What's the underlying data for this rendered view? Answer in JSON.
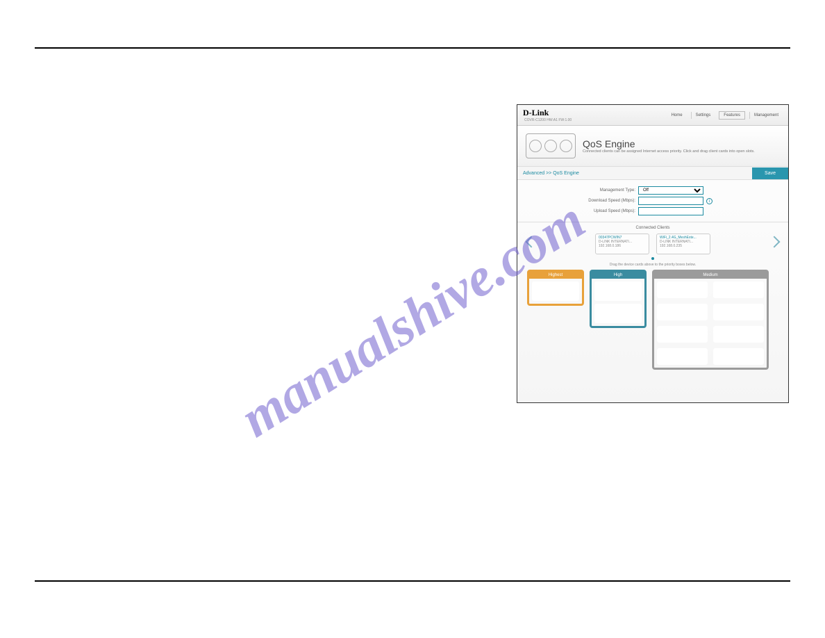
{
  "watermark": "manualshive.com",
  "shot": {
    "brand": "D-Link",
    "model": "COVR-C1200 HW:A1 FW:1.00",
    "nav": {
      "home": "Home",
      "settings": "Settings",
      "features": "Features",
      "management": "Management"
    },
    "banner": {
      "title": "QoS Engine",
      "desc": "Connected clients can be assigned Internet access priority. Click and drag client cards into open slots."
    },
    "crumb": "Advanced >> QoS Engine",
    "save": "Save",
    "form": {
      "mgmt_label": "Management Type:",
      "mgmt_value": "Off",
      "dl_label": "Download Speed (Mbps):",
      "ul_label": "Upload Speed (Mbps):"
    },
    "cc_title": "Connected Clients",
    "clients": [
      {
        "name": "00347PCWIN7",
        "vendor": "D-LINK INTERNATI...",
        "ip": "192.168.0.186"
      },
      {
        "name": "WiFi_2.4G_MeshExte...",
        "vendor": "D-LINK INTERNATI...",
        "ip": "192.168.0.235"
      }
    ],
    "draghint": "Drag the device cards above to the priority boxes below.",
    "prio": {
      "highest": "Highest",
      "high": "High",
      "medium": "Medium"
    }
  }
}
